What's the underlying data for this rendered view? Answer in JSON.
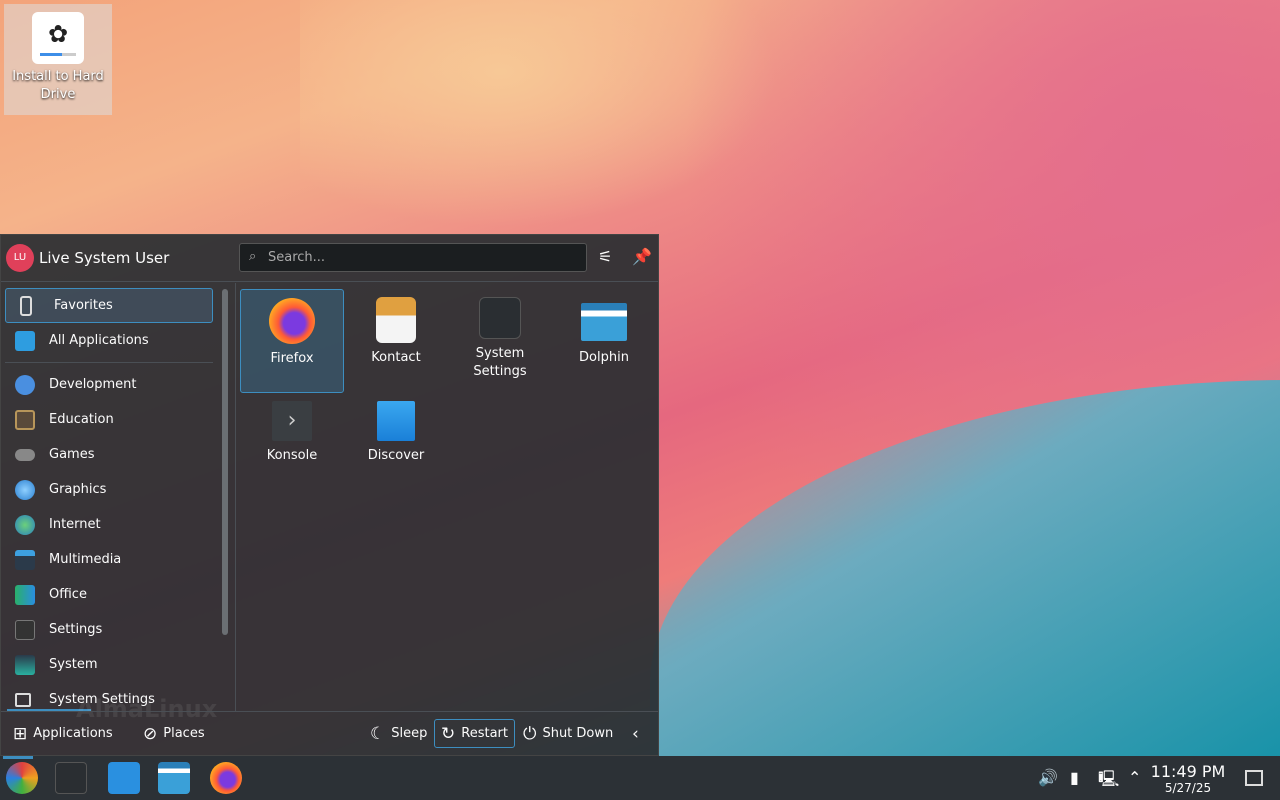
{
  "desktop": {
    "icons": [
      {
        "label": "Install to Hard Drive",
        "icon": "installer-icon"
      }
    ]
  },
  "menu": {
    "user": {
      "initials": "LU",
      "name": "Live System User"
    },
    "search": {
      "placeholder": "Search..."
    },
    "sidebar": [
      {
        "label": "Favorites",
        "icon": "bookmark-icon",
        "selected": true
      },
      {
        "label": "All Applications",
        "icon": "grid-icon"
      },
      {
        "label": "Development",
        "icon": "hammer-icon"
      },
      {
        "label": "Education",
        "icon": "education-icon"
      },
      {
        "label": "Games",
        "icon": "gamepad-icon"
      },
      {
        "label": "Graphics",
        "icon": "graphics-icon"
      },
      {
        "label": "Internet",
        "icon": "globe-icon"
      },
      {
        "label": "Multimedia",
        "icon": "multimedia-icon"
      },
      {
        "label": "Office",
        "icon": "office-icon"
      },
      {
        "label": "Settings",
        "icon": "settings-icon"
      },
      {
        "label": "System",
        "icon": "system-icon"
      },
      {
        "label": "System Settings",
        "icon": "folder-icon"
      }
    ],
    "favorites": [
      {
        "label": "Firefox",
        "selected": true
      },
      {
        "label": "Kontact"
      },
      {
        "label": "System Settings"
      },
      {
        "label": "Dolphin"
      },
      {
        "label": "Konsole"
      },
      {
        "label": "Discover"
      }
    ],
    "footer": {
      "applications": "Applications",
      "places": "Places",
      "sleep": "Sleep",
      "restart": "Restart",
      "shutdown": "Shut Down"
    },
    "watermark": "AlmaLinux"
  },
  "taskbar": {
    "time": "11:49 PM",
    "date": "5/27/25"
  },
  "colors": {
    "accent": "#3d8ec0",
    "panel": "#2a2e32"
  }
}
